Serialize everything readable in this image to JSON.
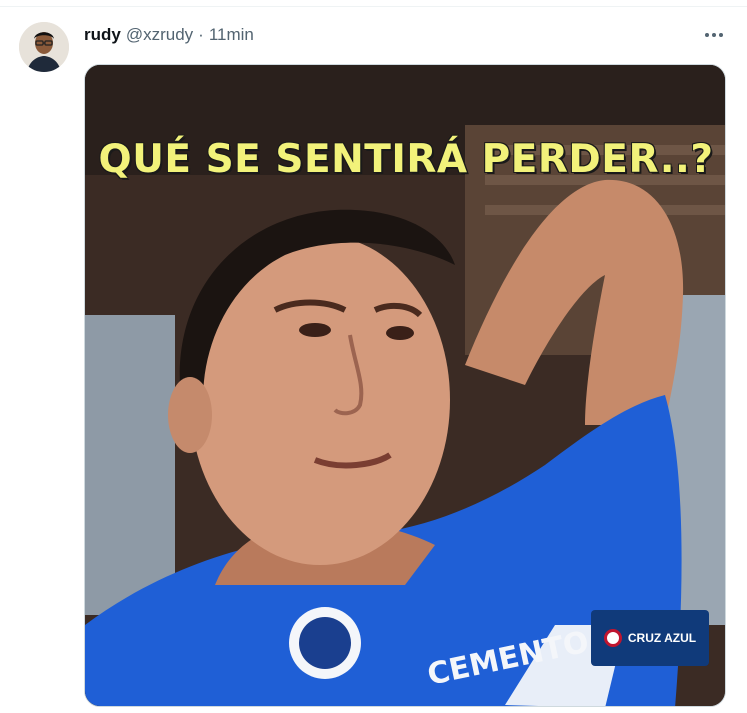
{
  "tweet": {
    "name": "rudy",
    "handle": "@xzrudy",
    "separator": "·",
    "time": "11min",
    "more_label": "•••",
    "media": {
      "caption": "QUÉ SE SENTIRÁ PERDER..?",
      "jersey_text": "CEMENTO",
      "watermark": "CRUZ AZUL"
    }
  },
  "colors": {
    "name": "#0f1419",
    "muted": "#536471",
    "caption": "#f2f27a",
    "jersey": "#1f5fd6"
  }
}
